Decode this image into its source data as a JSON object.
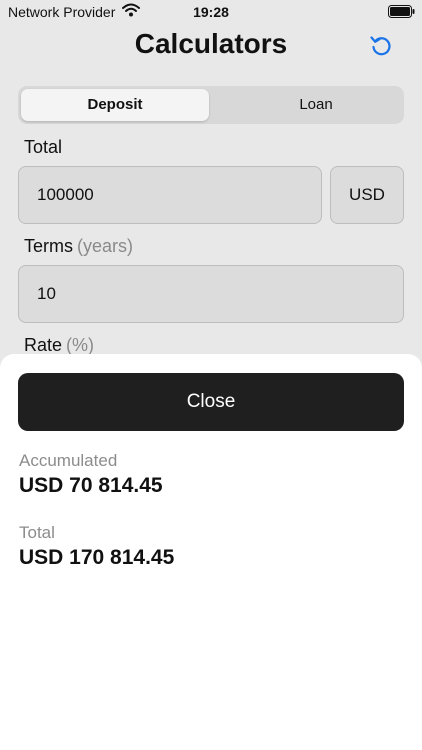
{
  "status_bar": {
    "carrier": "Network Provider",
    "time": "19:28",
    "wifi_icon": "wifi-icon",
    "battery_icon": "battery-icon"
  },
  "header": {
    "title": "Calculators",
    "reset_icon": "reset-icon",
    "accent_color": "#1a73e8"
  },
  "segmented": {
    "options": [
      "Deposit",
      "Loan"
    ],
    "selected": "Deposit"
  },
  "form": {
    "total_label": "Total",
    "total_value": "100000",
    "currency": "USD",
    "terms_label": "Terms",
    "terms_hint": "(years)",
    "terms_value": "10",
    "rate_label": "Rate",
    "rate_hint": "(%)"
  },
  "sheet": {
    "close_label": "Close",
    "accumulated_label": "Accumulated",
    "accumulated_value": "USD 70 814.45",
    "total_label": "Total",
    "total_value": "USD 170 814.45"
  }
}
